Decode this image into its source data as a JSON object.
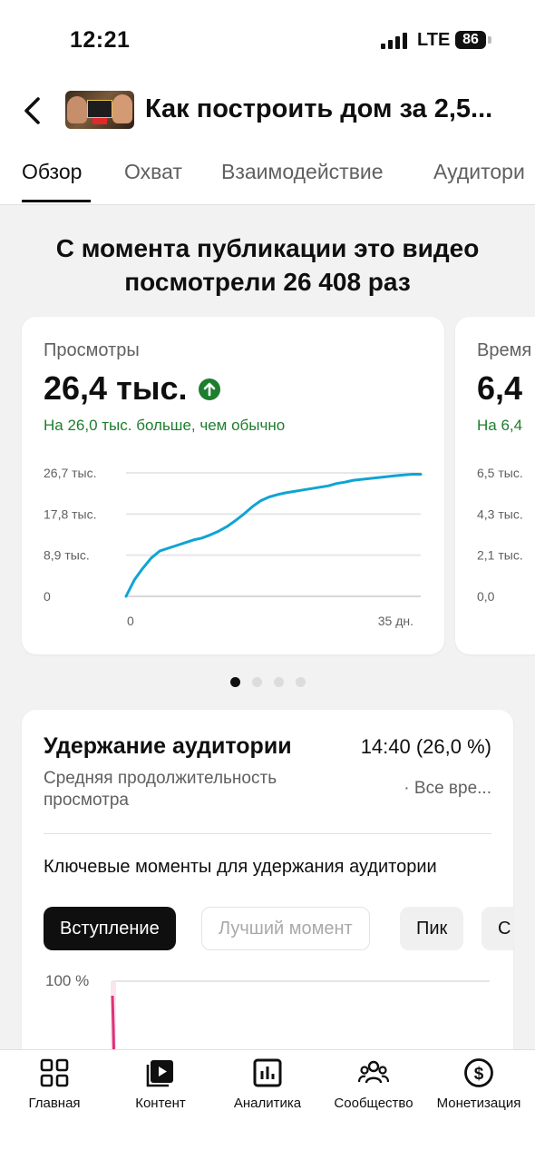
{
  "status": {
    "time": "12:21",
    "network": "LTE",
    "battery": "86"
  },
  "header": {
    "back_icon": "chevron-left-icon",
    "title": "Как построить дом за 2,5..."
  },
  "tabs": [
    {
      "label": "Обзор",
      "active": true
    },
    {
      "label": "Охват",
      "active": false
    },
    {
      "label": "Взаимодействие",
      "active": false
    },
    {
      "label": "Аудитори",
      "active": false
    }
  ],
  "summary": {
    "line1": "С момента публикации это видео",
    "line2": "посмотрели 26 408 раз"
  },
  "views_card": {
    "label": "Просмотры",
    "value": "26,4 тыс.",
    "trend_icon": "arrow-up-circle-icon",
    "note": "На 26,0 тыс. больше, чем обычно",
    "accent_color": "#1d7e2e",
    "chart_data": {
      "type": "line",
      "title": "",
      "xlabel": "",
      "ylabel": "",
      "y_ticks": [
        "26,7 тыс.",
        "17,8 тыс.",
        "8,9 тыс.",
        "0"
      ],
      "x_ticks": [
        "0",
        "35 дн."
      ],
      "ylim": [
        0,
        26700
      ],
      "xlim": [
        0,
        35
      ],
      "grid": true,
      "series": [
        {
          "color": "#10a4d4",
          "x": [
            0,
            1,
            2,
            3,
            4,
            5,
            6,
            7,
            8,
            9,
            10,
            11,
            12,
            13,
            14,
            15,
            16,
            17,
            18,
            19,
            20,
            21,
            22,
            23,
            24,
            25,
            26,
            27,
            28,
            29,
            30,
            31,
            32,
            33,
            34,
            35
          ],
          "y": [
            0,
            3600,
            6100,
            8300,
            9800,
            10400,
            11000,
            11600,
            12200,
            12600,
            13300,
            14100,
            15100,
            16400,
            17800,
            19400,
            20700,
            21500,
            22000,
            22400,
            22700,
            23000,
            23300,
            23600,
            23900,
            24400,
            24700,
            25100,
            25300,
            25500,
            25700,
            25900,
            26100,
            26250,
            26400,
            26408
          ]
        }
      ]
    }
  },
  "watch_card": {
    "label": "Время",
    "value": "6,4",
    "note": "На 6,4",
    "chart_data": {
      "type": "line",
      "y_ticks": [
        "6,5 тыс.",
        "4,3 тыс.",
        "2,1 тыс.",
        "0,0"
      ],
      "ylim": [
        0,
        6500
      ]
    }
  },
  "pager": {
    "count": 4,
    "active_index": 0
  },
  "retention": {
    "title": "Удержание аудитории",
    "value": "14:40 (26,0 %)",
    "subtitle": "Средняя продолжительность просмотра",
    "period": "· Все вре...",
    "key_moments_label": "Ключевые моменты для удержания аудитории",
    "chips": [
      "Вступление",
      "Лучший момент",
      "Пик",
      "С"
    ],
    "active_chip_index": 0,
    "y_tick": "100 %",
    "line_color": "#e0307a"
  },
  "bottom_nav": [
    {
      "label": "Главная",
      "icon": "home-grid-icon"
    },
    {
      "label": "Контент",
      "icon": "content-play-icon"
    },
    {
      "label": "Аналитика",
      "icon": "analytics-chart-icon"
    },
    {
      "label": "Сообщество",
      "icon": "community-people-icon"
    },
    {
      "label": "Монетизация",
      "icon": "monetization-dollar-icon"
    }
  ]
}
